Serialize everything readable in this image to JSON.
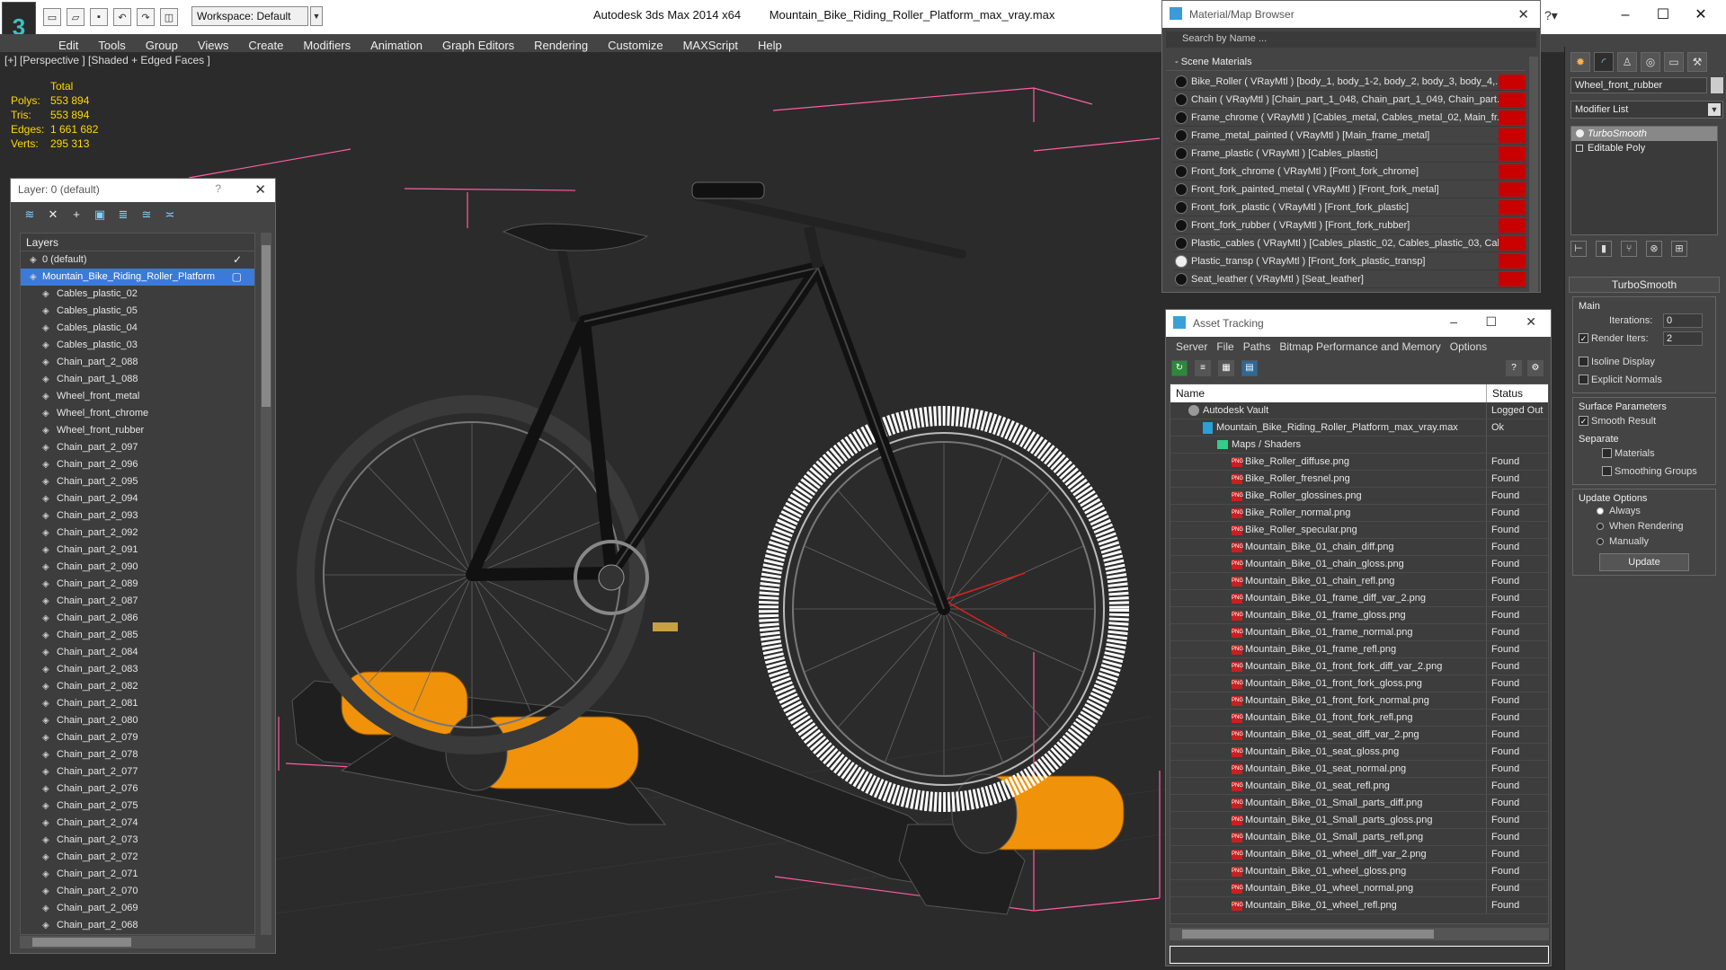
{
  "titlebar": {
    "app": "Autodesk 3ds Max  2014 x64",
    "file": "Mountain_Bike_Riding_Roller_Platform_max_vray.max",
    "workspace": "Workspace: Default",
    "minimize": "–",
    "maximize": "☐",
    "close": "✕"
  },
  "menu": [
    "Edit",
    "Tools",
    "Group",
    "Views",
    "Create",
    "Modifiers",
    "Animation",
    "Graph Editors",
    "Rendering",
    "Customize",
    "MAXScript",
    "Help"
  ],
  "viewport": {
    "label": "[+] [Perspective ] [Shaded + Edged Faces ]",
    "stats_header": "Total",
    "stats": [
      {
        "label": "Polys:",
        "value": "553 894"
      },
      {
        "label": "Tris:",
        "value": "553 894"
      },
      {
        "label": "Edges:",
        "value": "1 661 682"
      },
      {
        "label": "Verts:",
        "value": "295 313"
      }
    ]
  },
  "layer_panel": {
    "title": "Layer: 0 (default)",
    "help": "?",
    "close": "✕",
    "header": "Layers",
    "layers": [
      {
        "name": "0 (default)",
        "top": true,
        "check": "✓"
      },
      {
        "name": "Mountain_Bike_Riding_Roller_Platform",
        "top": true,
        "selected": true,
        "check": "▢"
      },
      {
        "name": "Cables_plastic_02"
      },
      {
        "name": "Cables_plastic_05"
      },
      {
        "name": "Cables_plastic_04"
      },
      {
        "name": "Cables_plastic_03"
      },
      {
        "name": "Chain_part_2_088"
      },
      {
        "name": "Chain_part_1_088"
      },
      {
        "name": "Wheel_front_metal"
      },
      {
        "name": "Wheel_front_chrome"
      },
      {
        "name": "Wheel_front_rubber"
      },
      {
        "name": "Chain_part_2_097"
      },
      {
        "name": "Chain_part_2_096"
      },
      {
        "name": "Chain_part_2_095"
      },
      {
        "name": "Chain_part_2_094"
      },
      {
        "name": "Chain_part_2_093"
      },
      {
        "name": "Chain_part_2_092"
      },
      {
        "name": "Chain_part_2_091"
      },
      {
        "name": "Chain_part_2_090"
      },
      {
        "name": "Chain_part_2_089"
      },
      {
        "name": "Chain_part_2_087"
      },
      {
        "name": "Chain_part_2_086"
      },
      {
        "name": "Chain_part_2_085"
      },
      {
        "name": "Chain_part_2_084"
      },
      {
        "name": "Chain_part_2_083"
      },
      {
        "name": "Chain_part_2_082"
      },
      {
        "name": "Chain_part_2_081"
      },
      {
        "name": "Chain_part_2_080"
      },
      {
        "name": "Chain_part_2_079"
      },
      {
        "name": "Chain_part_2_078"
      },
      {
        "name": "Chain_part_2_077"
      },
      {
        "name": "Chain_part_2_076"
      },
      {
        "name": "Chain_part_2_075"
      },
      {
        "name": "Chain_part_2_074"
      },
      {
        "name": "Chain_part_2_073"
      },
      {
        "name": "Chain_part_2_072"
      },
      {
        "name": "Chain_part_2_071"
      },
      {
        "name": "Chain_part_2_070"
      },
      {
        "name": "Chain_part_2_069"
      },
      {
        "name": "Chain_part_2_068"
      }
    ]
  },
  "material_browser": {
    "title": "Material/Map Browser",
    "close": "✕",
    "search_placeholder": "Search by Name ...",
    "section": "- Scene Materials",
    "materials": [
      "Bike_Roller  ( VRayMtl ) [body_1, body_1-2, body_2, body_3, body_4,...",
      "Chain  ( VRayMtl ) [Chain_part_1_048, Chain_part_1_049, Chain_part...",
      "Frame_chrome  ( VRayMtl ) [Cables_metal, Cables_metal_02, Main_fr...",
      "Frame_metal_painted  ( VRayMtl ) [Main_frame_metal]",
      "Frame_plastic  ( VRayMtl ) [Cables_plastic]",
      "Front_fork_chrome  ( VRayMtl ) [Front_fork_chrome]",
      "Front_fork_painted_metal  ( VRayMtl ) [Front_fork_metal]",
      "Front_fork_plastic  ( VRayMtl ) [Front_fork_plastic]",
      "Front_fork_rubber  ( VRayMtl ) [Front_fork_rubber]",
      "Plastic_cables  ( VRayMtl ) [Cables_plastic_02, Cables_plastic_03, Cabl...",
      "Plastic_transp  ( VRayMtl ) [Front_fork_plastic_transp]",
      "Seat_leather  ( VRayMtl ) [Seat_leather]"
    ]
  },
  "asset_tracking": {
    "title": "Asset Tracking",
    "minimize": "–",
    "maximize": "☐",
    "close": "✕",
    "menu": [
      "Server",
      "File",
      "Paths",
      "Bitmap Performance and Memory",
      "Options"
    ],
    "col_name": "Name",
    "col_status": "Status",
    "rows": [
      {
        "name": "Autodesk Vault",
        "status": "Logged Out",
        "kind": "vault",
        "indent": 20
      },
      {
        "name": "Mountain_Bike_Riding_Roller_Platform_max_vray.max",
        "status": "Ok",
        "kind": "file",
        "indent": 36
      },
      {
        "name": "Maps / Shaders",
        "status": "",
        "kind": "folder",
        "indent": 52
      },
      {
        "name": "Bike_Roller_diffuse.png",
        "status": "Found",
        "kind": "png",
        "indent": 68
      },
      {
        "name": "Bike_Roller_fresnel.png",
        "status": "Found",
        "kind": "png",
        "indent": 68
      },
      {
        "name": "Bike_Roller_glossines.png",
        "status": "Found",
        "kind": "png",
        "indent": 68
      },
      {
        "name": "Bike_Roller_normal.png",
        "status": "Found",
        "kind": "png",
        "indent": 68
      },
      {
        "name": "Bike_Roller_specular.png",
        "status": "Found",
        "kind": "png",
        "indent": 68
      },
      {
        "name": "Mountain_Bike_01_chain_diff.png",
        "status": "Found",
        "kind": "png",
        "indent": 68
      },
      {
        "name": "Mountain_Bike_01_chain_gloss.png",
        "status": "Found",
        "kind": "png",
        "indent": 68
      },
      {
        "name": "Mountain_Bike_01_chain_refl.png",
        "status": "Found",
        "kind": "png",
        "indent": 68
      },
      {
        "name": "Mountain_Bike_01_frame_diff_var_2.png",
        "status": "Found",
        "kind": "png",
        "indent": 68
      },
      {
        "name": "Mountain_Bike_01_frame_gloss.png",
        "status": "Found",
        "kind": "png",
        "indent": 68
      },
      {
        "name": "Mountain_Bike_01_frame_normal.png",
        "status": "Found",
        "kind": "png",
        "indent": 68
      },
      {
        "name": "Mountain_Bike_01_frame_refl.png",
        "status": "Found",
        "kind": "png",
        "indent": 68
      },
      {
        "name": "Mountain_Bike_01_front_fork_diff_var_2.png",
        "status": "Found",
        "kind": "png",
        "indent": 68
      },
      {
        "name": "Mountain_Bike_01_front_fork_gloss.png",
        "status": "Found",
        "kind": "png",
        "indent": 68
      },
      {
        "name": "Mountain_Bike_01_front_fork_normal.png",
        "status": "Found",
        "kind": "png",
        "indent": 68
      },
      {
        "name": "Mountain_Bike_01_front_fork_refl.png",
        "status": "Found",
        "kind": "png",
        "indent": 68
      },
      {
        "name": "Mountain_Bike_01_seat_diff_var_2.png",
        "status": "Found",
        "kind": "png",
        "indent": 68
      },
      {
        "name": "Mountain_Bike_01_seat_gloss.png",
        "status": "Found",
        "kind": "png",
        "indent": 68
      },
      {
        "name": "Mountain_Bike_01_seat_normal.png",
        "status": "Found",
        "kind": "png",
        "indent": 68
      },
      {
        "name": "Mountain_Bike_01_seat_refl.png",
        "status": "Found",
        "kind": "png",
        "indent": 68
      },
      {
        "name": "Mountain_Bike_01_Small_parts_diff.png",
        "status": "Found",
        "kind": "png",
        "indent": 68
      },
      {
        "name": "Mountain_Bike_01_Small_parts_gloss.png",
        "status": "Found",
        "kind": "png",
        "indent": 68
      },
      {
        "name": "Mountain_Bike_01_Small_parts_refl.png",
        "status": "Found",
        "kind": "png",
        "indent": 68
      },
      {
        "name": "Mountain_Bike_01_wheel_diff_var_2.png",
        "status": "Found",
        "kind": "png",
        "indent": 68
      },
      {
        "name": "Mountain_Bike_01_wheel_gloss.png",
        "status": "Found",
        "kind": "png",
        "indent": 68
      },
      {
        "name": "Mountain_Bike_01_wheel_normal.png",
        "status": "Found",
        "kind": "png",
        "indent": 68
      },
      {
        "name": "Mountain_Bike_01_wheel_refl.png",
        "status": "Found",
        "kind": "png",
        "indent": 68
      }
    ]
  },
  "command_panel": {
    "object_name": "Wheel_front_rubber",
    "modifier_list": "Modifier List",
    "stack": [
      {
        "name": "TurboSmooth",
        "active": true
      },
      {
        "name": "Editable Poly",
        "active": false
      }
    ],
    "turbosmooth": {
      "title": "TurboSmooth",
      "main": "Main",
      "iterations_label": "Iterations:",
      "iterations": "0",
      "render_iters_label": "Render Iters:",
      "render_iters": "2",
      "isoline": "Isoline Display",
      "explicit_normals": "Explicit Normals",
      "surface_params": "Surface Parameters",
      "smooth_result": "Smooth Result",
      "separate": "Separate",
      "materials": "Materials",
      "smoothing_groups": "Smoothing Groups",
      "update_options": "Update Options",
      "always": "Always",
      "when_rendering": "When Rendering",
      "manually": "Manually",
      "update": "Update"
    }
  },
  "colors": {
    "accent": "#3b7ad8",
    "roller": "#f0920a",
    "stats": "#ffd800",
    "bbox": "#ff5fa0",
    "missing_map": "#c80000"
  }
}
